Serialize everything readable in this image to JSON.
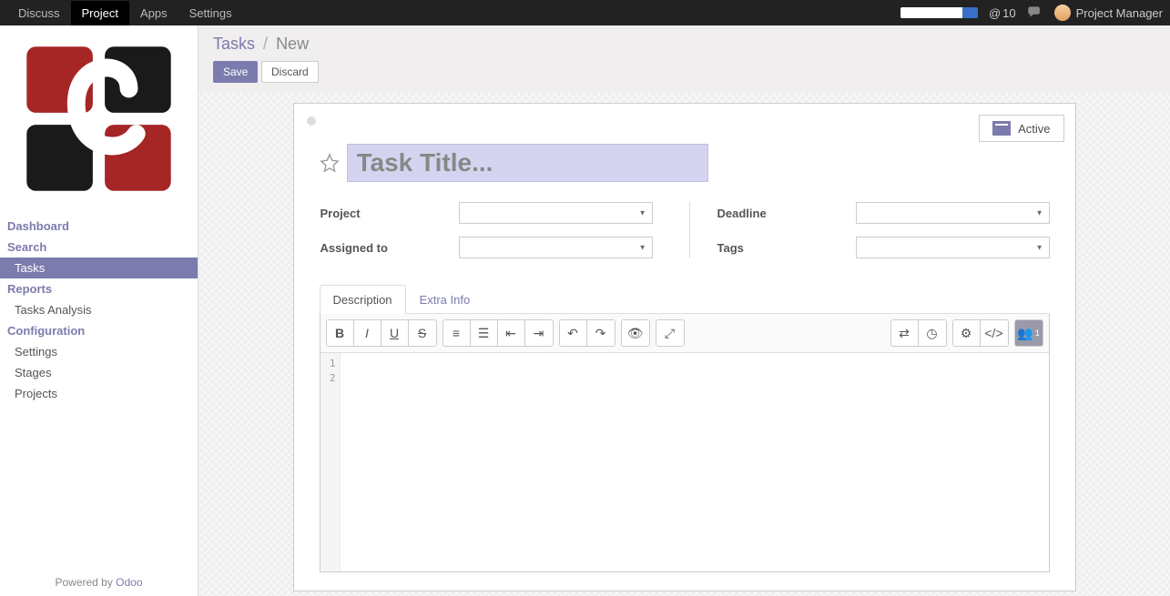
{
  "navbar": {
    "items": [
      "Discuss",
      "Project",
      "Apps",
      "Settings"
    ],
    "active_index": 1,
    "notification_count": "10",
    "user_name": "Project Manager"
  },
  "sidebar": {
    "sections": [
      {
        "type": "heading",
        "label": "Dashboard"
      },
      {
        "type": "heading",
        "label": "Search"
      },
      {
        "type": "item",
        "label": "Tasks",
        "active": true
      },
      {
        "type": "heading",
        "label": "Reports"
      },
      {
        "type": "item",
        "label": "Tasks Analysis"
      },
      {
        "type": "heading",
        "label": "Configuration"
      },
      {
        "type": "item",
        "label": "Settings"
      },
      {
        "type": "item",
        "label": "Stages"
      },
      {
        "type": "item",
        "label": "Projects"
      }
    ],
    "footer_prefix": "Powered by ",
    "footer_link": "Odoo"
  },
  "breadcrumb": {
    "parent": "Tasks",
    "current": "New"
  },
  "buttons": {
    "save": "Save",
    "discard": "Discard"
  },
  "form": {
    "status_label": "Active",
    "title_placeholder": "Task Title...",
    "fields": {
      "project": "Project",
      "assigned_to": "Assigned to",
      "deadline": "Deadline",
      "tags": "Tags"
    },
    "tabs": {
      "description": "Description",
      "extra_info": "Extra Info"
    },
    "gutter_lines": [
      "1",
      "2"
    ],
    "collab_count": "1"
  }
}
